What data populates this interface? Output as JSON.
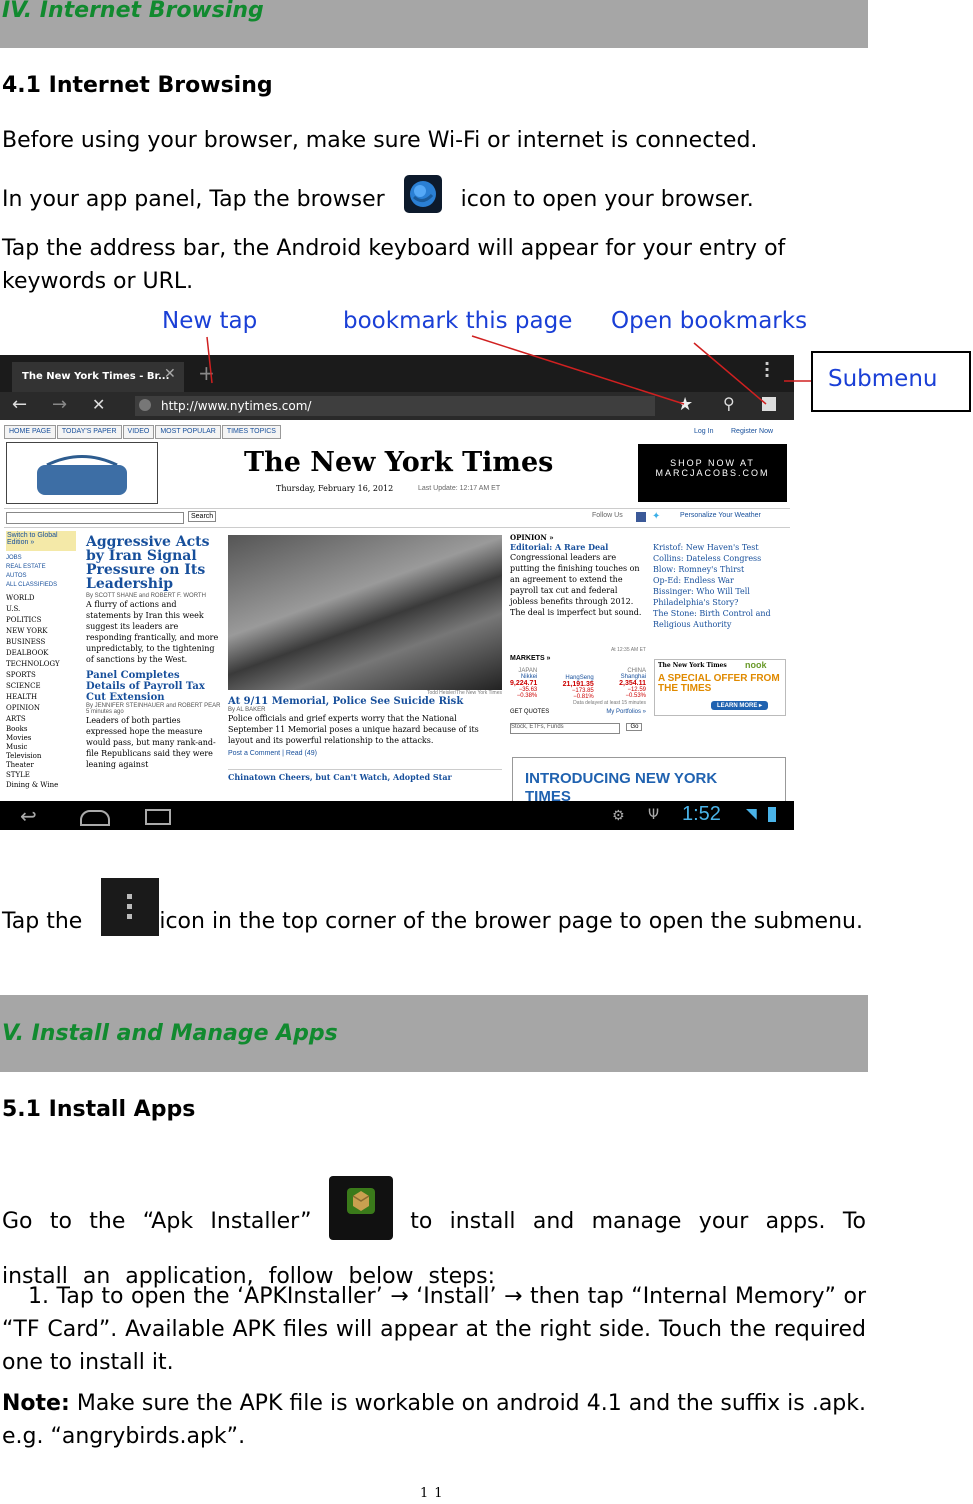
{
  "section4": {
    "bar_title": "IV. Internet Browsing",
    "heading": "4.1 Internet Browsing"
  },
  "para1": "Before using your browser, make sure Wi-Fi or internet is connected.",
  "para2": {
    "before": "In your app panel, Tap the browser",
    "after": "icon to open your browser."
  },
  "para3": "Tap the address bar, the Android keyboard will appear for your entry of keywords or URL.",
  "callouts": {
    "new_tab": "New tap",
    "bookmark": "bookmark this page",
    "open_bookmarks": "Open bookmarks",
    "submenu": "Submenu"
  },
  "screenshot": {
    "tab_title": "The New York Times - Br...",
    "url": "http://www.nytimes.com/",
    "nav_tabs": [
      "HOME PAGE",
      "TODAY'S PAPER",
      "VIDEO",
      "MOST POPULAR",
      "TIMES TOPICS"
    ],
    "login": "Log In",
    "register": "Register Now",
    "masthead": "The New York Times",
    "date": "Thursday, February 16, 2012",
    "last_update": "Last Update: 12:17 AM ET",
    "ad": "SHOP NOW AT MARCJACOBS.COM",
    "search_button": "Search",
    "follow_us": "Follow Us",
    "weather": "Personalize Your Weather",
    "left_nav": [
      "Switch to Global Edition »",
      "JOBS",
      "REAL ESTATE",
      "AUTOS",
      "ALL CLASSIFIEDS",
      "WORLD",
      "U.S.",
      "POLITICS",
      "NEW YORK",
      "BUSINESS",
      "DEALBOOK",
      "TECHNOLOGY",
      "SPORTS",
      "SCIENCE",
      "HEALTH",
      "OPINION",
      "ARTS",
      "Books",
      "Movies",
      "Music",
      "Television",
      "Theater",
      "STYLE",
      "Dining & Wine"
    ],
    "story1_head": "Aggressive Acts by Iran Signal Pressure on Its Leadership",
    "story1_byline": "By SCOTT SHANE and ROBERT F. WORTH",
    "story1_body": "A flurry of actions and statements by Iran this week suggest its leaders are responding frantically, and more unpredictably, to the tightening of sanctions by the West.",
    "story2_head": "Panel Completes Details of Payroll Tax Cut Extension",
    "story2_byline": "By JENNIFER STEINHAUER and ROBERT PEAR 5 minutes ago",
    "story2_body": "Leaders of both parties expressed hope the measure would pass, but many rank-and-file Republicans said they were leaning against",
    "photo_credit": "Todd Heisler/The New York Times",
    "story3_head": "At 9/11 Memorial, Police See Suicide Risk",
    "story3_byline": "By AL BAKER",
    "story3_body": "Police officials and grief experts worry that the National September 11 Memorial poses a unique hazard because of its layout and its powerful relationship to the attacks.",
    "story3_links": "Post a Comment | Read (49)",
    "story4_head": "Chinatown Cheers, but Can't Watch, Adopted Star",
    "opinion_label": "OPINION »",
    "opinion_head": "Editorial: A Rare Deal",
    "opinion_body": "Congressional leaders are putting the finishing touches on an agreement to extend the payroll tax cut and federal jobless benefits through 2012. The deal is imperfect but sound.",
    "opinion_links": [
      "Kristof: New Haven's Test",
      "Collins: Dateless Congress",
      "Blow: Romney's Thirst",
      "Op-Ed: Endless War",
      "Bissinger: Who Will Tell Philadelphia's Story?",
      "The Stone: Birth Control and Religious Authority"
    ],
    "markets_label": "MARKETS »",
    "markets_time": "At 12:35 AM ET",
    "markets": [
      {
        "region": "JAPAN",
        "name": "Nikkei",
        "value": "9,224.71",
        "change": "−35.63",
        "pct": "−0.38%"
      },
      {
        "region": "",
        "name": "HangSeng",
        "value": "21,191.35",
        "change": "−173.85",
        "pct": "−0.81%"
      },
      {
        "region": "CHINA",
        "name": "Shanghai",
        "value": "2,354.11",
        "change": "−12.59",
        "pct": "−0.53%"
      }
    ],
    "markets_note": "Data delayed at least 15 minutes",
    "quotes_label": "GET QUOTES",
    "portfolios": "My Portfolios »",
    "quotes_placeholder": "Stock, ETFs, Funds",
    "go": "Go",
    "promo_brand": "The New York Times",
    "promo_partner": "nook",
    "promo_text": "A SPECIAL OFFER FROM THE TIMES",
    "promo_button": "LEARN MORE ▸",
    "intro_text": "INTRODUCING NEW YORK TIMES",
    "clock": "1:52"
  },
  "para4": {
    "before": "Tap the",
    "after": "icon in the top corner of the brower page to open the submenu."
  },
  "section5": {
    "bar_title": "V. Install and Manage Apps",
    "heading": "5.1 Install Apps"
  },
  "para5": {
    "before": "Go to the “Apk Installer”",
    "after": "to install and manage your apps. To install an application, follow below steps:",
    "icon_label": "ApkInstaller"
  },
  "step1": "1. Tap to open the ‘APKInstaller’ → ‘Install’ → then tap “Internal Memory” or “TF Card”. Available APK files will appear at the right side. Touch the required one to install it.",
  "note": {
    "label": "Note:",
    "text": "Make sure the APK file is workable on android 4.1 and the suffix is .apk. e.g. “angrybirds.apk”."
  },
  "page_number": "11"
}
